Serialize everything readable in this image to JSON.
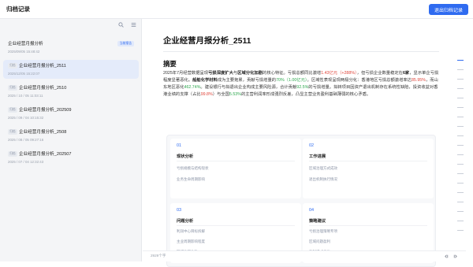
{
  "topbar": {
    "title": "归档记录",
    "exit_label": "退出归档记录"
  },
  "sidebar": {
    "items": [
      {
        "tag": "",
        "name": "企业经营月报分析",
        "time": "2025/09/05 15:48:42",
        "badge": "当前报告",
        "active": false
      },
      {
        "tag": "归档",
        "name": "企业经营月报分析_2511",
        "time": "2025/12/05 15:22:07",
        "badge": "",
        "active": true
      },
      {
        "tag": "归档",
        "name": "企业经营月报分析_2510",
        "time": "2025 / 10 / 05 11:03:11",
        "badge": "",
        "active": false
      },
      {
        "tag": "归档",
        "name": "企业经营月报分析_202509",
        "time": "2025 / 09 / 04 10:15:32",
        "badge": "",
        "active": false
      },
      {
        "tag": "归档",
        "name": "企业经营月报分析_2508",
        "time": "2025 / 08 / 05 09:27:16",
        "badge": "",
        "active": false
      },
      {
        "tag": "归档",
        "name": "企业经营月报分析_202507",
        "time": "2025 / 07 / 04 12:32:43",
        "badge": "",
        "active": false
      }
    ]
  },
  "doc": {
    "title": "企业经营月报分析_2511",
    "section": "摘要",
    "p": {
      "a": "2025年7月经营数据呈现",
      "b": "亏损深度扩大",
      "c": "与",
      "d": "区域分化加剧",
      "e": "的核心特征。亏损总额同比激增",
      "f": "1.43亿元",
      "g": "（+288%）",
      "h": "，但亏损企业数量稳定在",
      "i": "6家",
      "j": "，显示单企亏损程度显著恶化。",
      "k": "船舶化学材料",
      "l": "成为主要拖累，贡献亏损增量的",
      "m": "70%",
      "n": "（1.00亿元）",
      "o": "。区域性表现呈现两极分化：香港地区亏损总额激增率达",
      "q": "85.95%",
      "r": "，而山东地区恶化",
      "s": "462.74%",
      "t": "。建设银行与拟退出企业构成主要风险源，合计贡献",
      "u": "92.5%",
      "v": "的亏损增量。拟转项目因资产退出机制存在系统性缺陷，投资收益对香港业绩的支撑（占比",
      "w": "99.8%",
      "x": "）与全国",
      "y": "5.53%",
      "z": "的主营利润率形成强烈反差，凸显主营业务盈利基础薄弱的核心矛盾。"
    },
    "cards": [
      {
        "num": "01",
        "title": "现状分析",
        "items": [
          "亏损规模与结构现状",
          "业务生命周期影响"
        ]
      },
      {
        "num": "02",
        "title": "工作进展",
        "items": [
          "区域治理方式成效",
          "退出机制执行情况"
        ]
      },
      {
        "num": "03",
        "title": "问题分析",
        "items": [
          "利润中心目标拆解",
          "主业周期影响程度",
          "区域治理失效"
        ]
      },
      {
        "num": "04",
        "title": "策略建议",
        "items": [
          "亏损治理策略专项",
          "区域问题盈利",
          "盈利模式优化"
        ]
      }
    ]
  },
  "footer": {
    "word_count": "2929个字"
  }
}
